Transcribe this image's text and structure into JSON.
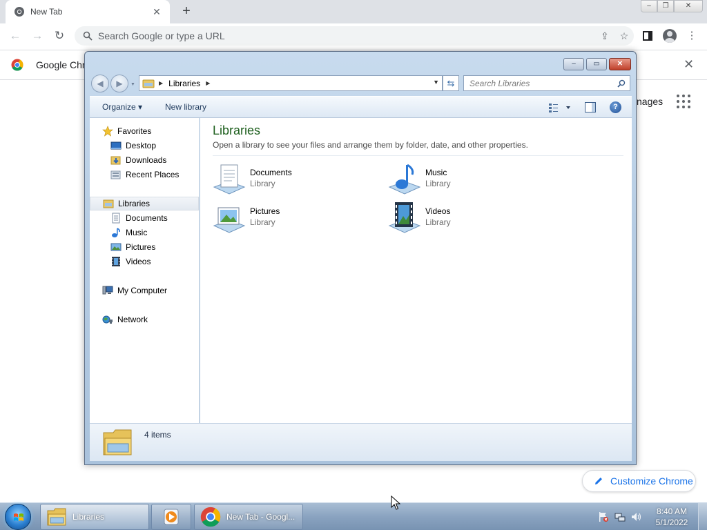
{
  "chrome": {
    "tab_title": "New Tab",
    "tab_close": "✕",
    "new_tab": "+",
    "window_controls": {
      "minimize": "–",
      "maximize": "❐",
      "close": "✕"
    },
    "nav": {
      "back": "←",
      "forward": "→",
      "reload": "↻"
    },
    "omnibox_placeholder": "Search Google or type a URL",
    "toolbar_icons": {
      "share": "⇪",
      "bookmark": "☆",
      "menu": "⋮"
    },
    "infobar_text": "Google Chro",
    "infobar_close": "✕",
    "ntp_images_link": "nages",
    "customize_label": "Customize Chrome"
  },
  "explorer": {
    "window_controls": {
      "minimize": "–",
      "maximize": "▭",
      "close": "✕"
    },
    "nav_back": "◀",
    "nav_forward": "▶",
    "address": {
      "crumb": "Libraries"
    },
    "refresh": "⇆",
    "search_placeholder": "Search Libraries",
    "commands": {
      "organize": "Organize ▾",
      "new_library": "New library",
      "help": "?"
    },
    "nav_pane": {
      "favorites": "Favorites",
      "favorites_items": [
        "Desktop",
        "Downloads",
        "Recent Places"
      ],
      "libraries": "Libraries",
      "libraries_items": [
        "Documents",
        "Music",
        "Pictures",
        "Videos"
      ],
      "computer": "My Computer",
      "network": "Network"
    },
    "content": {
      "title": "Libraries",
      "subtitle": "Open a library to see your files and arrange them by folder, date, and other properties.",
      "items": [
        {
          "name": "Documents",
          "type": "Library"
        },
        {
          "name": "Music",
          "type": "Library"
        },
        {
          "name": "Pictures",
          "type": "Library"
        },
        {
          "name": "Videos",
          "type": "Library"
        }
      ]
    },
    "details": "4 items"
  },
  "taskbar": {
    "explorer_label": "Libraries",
    "chrome_label": "New Tab - Googl...",
    "clock_time": "8:40 AM",
    "clock_date": "5/1/2022"
  }
}
